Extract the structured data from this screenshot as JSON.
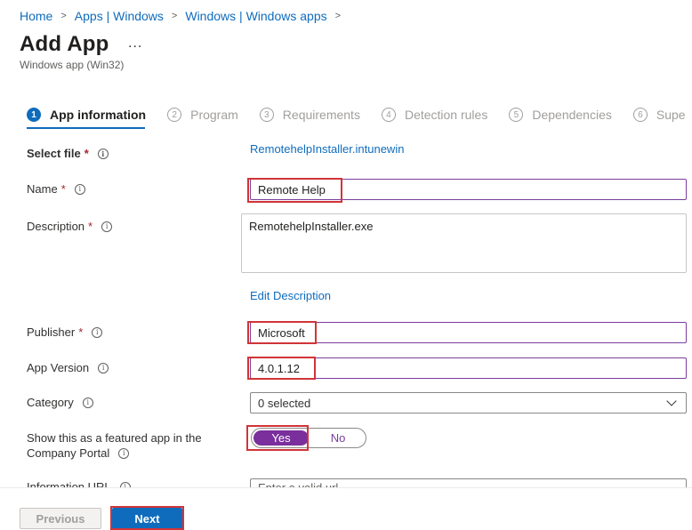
{
  "breadcrumb": [
    "Home",
    "Apps | Windows",
    "Windows | Windows apps"
  ],
  "page": {
    "title": "Add App",
    "more": "...",
    "subtitle": "Windows app (Win32)"
  },
  "tabs": [
    {
      "num": "1",
      "label": "App information"
    },
    {
      "num": "2",
      "label": "Program"
    },
    {
      "num": "3",
      "label": "Requirements"
    },
    {
      "num": "4",
      "label": "Detection rules"
    },
    {
      "num": "5",
      "label": "Dependencies"
    },
    {
      "num": "6",
      "label": "Supe"
    }
  ],
  "form": {
    "select_file": {
      "label": "Select file",
      "value": "RemotehelpInstaller.intunewin"
    },
    "name": {
      "label": "Name",
      "value": "Remote Help"
    },
    "description": {
      "label": "Description",
      "value": "RemotehelpInstaller.exe",
      "edit_link": "Edit Description"
    },
    "publisher": {
      "label": "Publisher",
      "value": "Microsoft"
    },
    "app_version": {
      "label": "App Version",
      "value": "4.0.1.12"
    },
    "category": {
      "label": "Category",
      "value": "0 selected"
    },
    "featured": {
      "label_line1": "Show this as a featured app in the",
      "label_line2": "Company Portal",
      "yes": "Yes",
      "no": "No"
    },
    "info_url": {
      "label": "Information URL",
      "placeholder": "Enter a valid url"
    }
  },
  "symbols": {
    "required": "*",
    "info": "i",
    "separator": ">"
  },
  "footer": {
    "previous": "Previous",
    "next": "Next"
  },
  "colors": {
    "accent": "#0f6cbd",
    "toggle_on": "#7a2f9c",
    "highlight": "#d13438",
    "required": "#a4262c"
  }
}
